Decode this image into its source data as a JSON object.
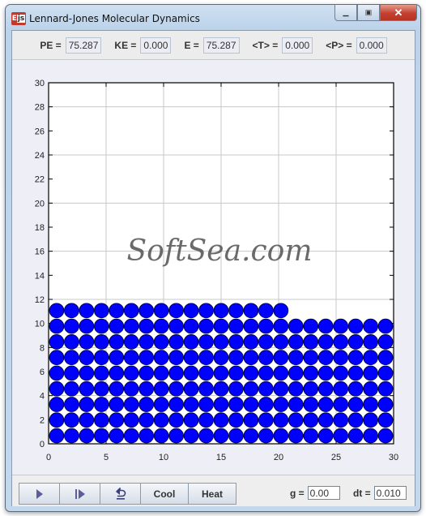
{
  "window": {
    "title": "Lennard-Jones Molecular Dynamics",
    "app_icon": "Ejs",
    "controls": {
      "minimize": "minimize-icon",
      "maximize": "maximize-icon",
      "close": "close-icon"
    }
  },
  "readouts": [
    {
      "label": "PE =",
      "value": "75.287",
      "name": "pe"
    },
    {
      "label": "KE =",
      "value": "0.000",
      "name": "ke"
    },
    {
      "label": "E =",
      "value": "75.287",
      "name": "e"
    },
    {
      "label": "<T> =",
      "value": "0.000",
      "name": "t"
    },
    {
      "label": "<P> =",
      "value": "0.000",
      "name": "p"
    }
  ],
  "plot": {
    "watermark": "SoftSea.com",
    "xlim": [
      0,
      30
    ],
    "ylim": [
      0,
      30
    ],
    "xticks": [
      0,
      5,
      10,
      15,
      20,
      25,
      30
    ],
    "yticks": [
      0,
      2,
      4,
      6,
      8,
      10,
      12,
      14,
      16,
      18,
      20,
      22,
      24,
      26,
      28,
      30
    ],
    "particle_color": "#0000ff",
    "particle_radius": 0.63,
    "lattice": {
      "x0": 0.7,
      "dx": 1.3,
      "y0": 0.67,
      "dy": 1.3,
      "full_rows": 8,
      "per_full_row": 23,
      "top_row_count": 16
    }
  },
  "toolbar": {
    "play": "play-icon",
    "step": "step-icon",
    "reset": "reset-icon",
    "cool_label": "Cool",
    "heat_label": "Heat"
  },
  "params": {
    "g_label": "g =",
    "g_value": "0.00",
    "dt_label": "dt =",
    "dt_value": "0.010"
  }
}
